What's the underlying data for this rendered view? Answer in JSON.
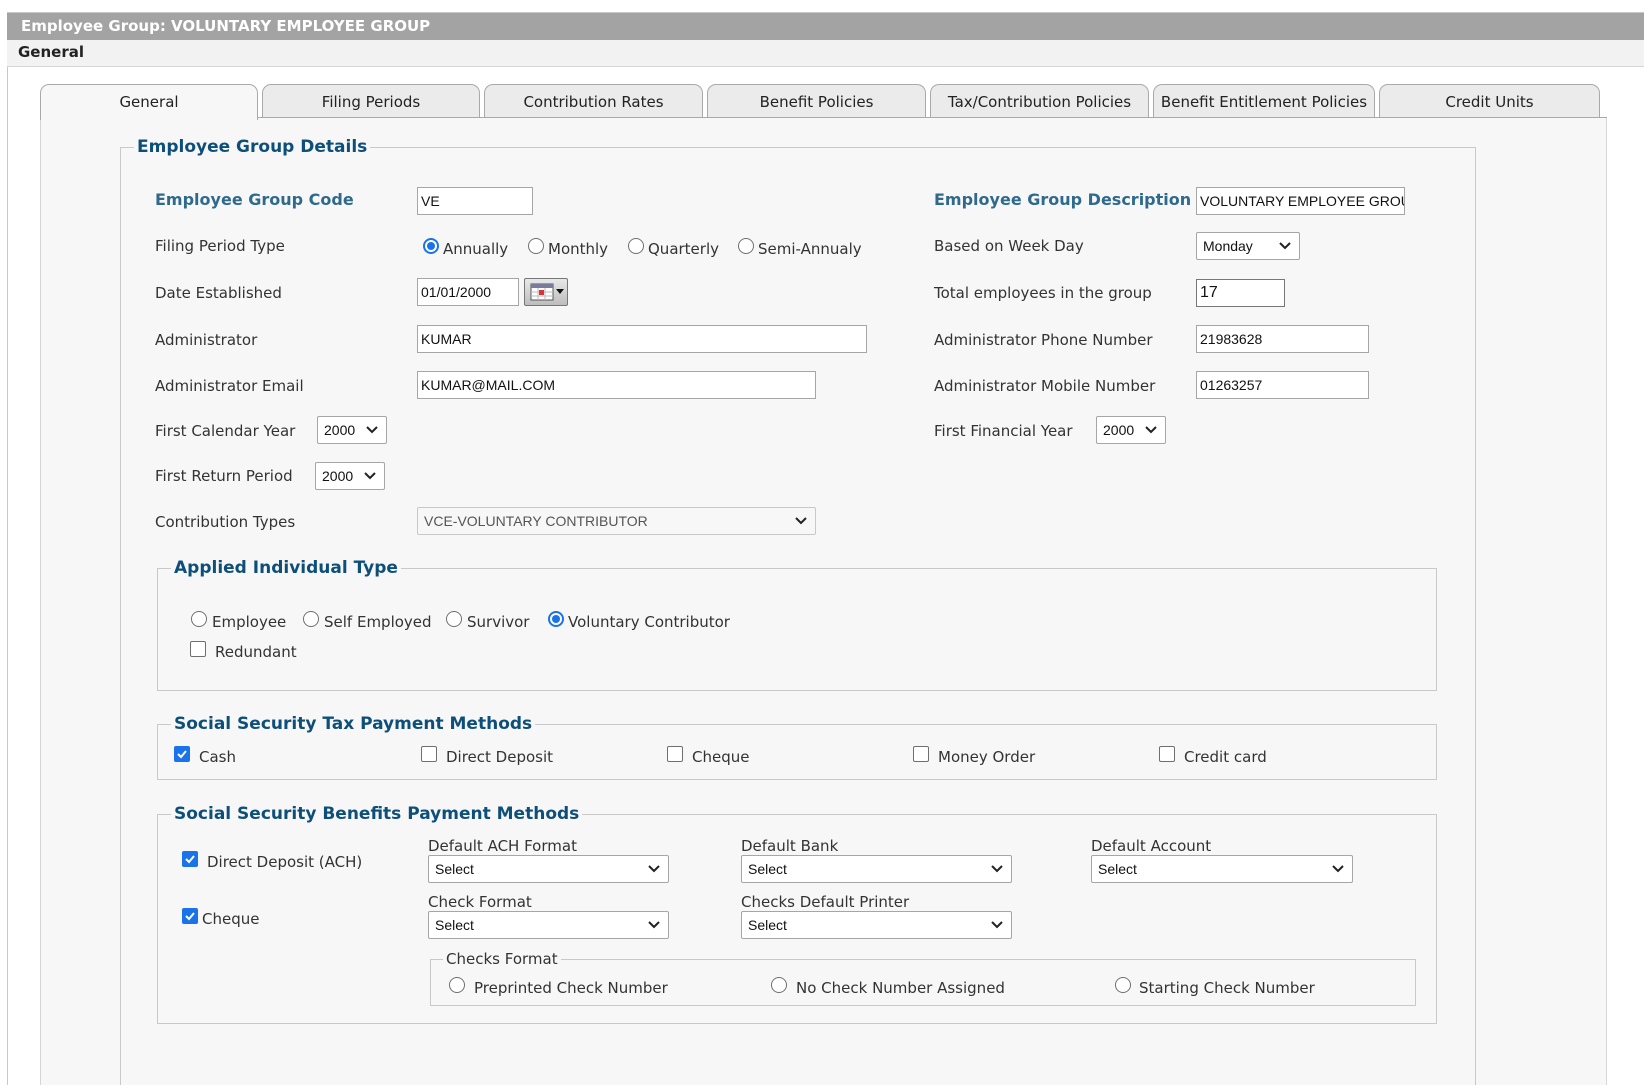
{
  "window": {
    "title": "Employee Group: VOLUNTARY EMPLOYEE GROUP",
    "section": "General"
  },
  "tabs": [
    "General",
    "Filing Periods",
    "Contribution Rates",
    "Benefit Policies",
    "Tax/Contribution Policies",
    "Benefit Entitlement Policies",
    "Credit Units"
  ],
  "active_tab": "General",
  "details": {
    "legend": "Employee Group Details",
    "code_label": "Employee Group Code",
    "code_value": "VE",
    "description_label": "Employee Group Description",
    "description_value": "VOLUNTARY EMPLOYEE GROUP",
    "filing_period_label": "Filing Period Type",
    "filing_period_options": [
      "Annually",
      "Monthly",
      "Quarterly",
      "Semi-Annualy"
    ],
    "filing_period_selected": "Annually",
    "week_day_label": "Based on Week Day",
    "week_day_value": "Monday",
    "date_label": "Date Established",
    "date_value": "01/01/2000",
    "total_label": "Total employees in the group",
    "total_value": "17",
    "admin_label": "Administrator",
    "admin_value": "KUMAR",
    "admin_phone_label": "Administrator Phone Number",
    "admin_phone_value": "21983628",
    "admin_email_label": "Administrator Email",
    "admin_email_value": "KUMAR@MAIL.COM",
    "admin_mobile_label": "Administrator Mobile Number",
    "admin_mobile_value": "01263257",
    "first_cal_year_label": "First Calendar Year",
    "first_cal_year_value": "2000",
    "first_fin_year_label": "First Financial Year",
    "first_fin_year_value": "2000",
    "first_return_label": "First Return Period",
    "first_return_value": "2000",
    "contribution_types_label": "Contribution Types",
    "contribution_types_value": "VCE-VOLUNTARY CONTRIBUTOR"
  },
  "applied_individual": {
    "legend": "Applied Individual Type",
    "options": [
      "Employee",
      "Self Employed",
      "Survivor",
      "Voluntary Contributor"
    ],
    "selected": "Voluntary Contributor",
    "redundant_label": "Redundant",
    "redundant_checked": false
  },
  "tax_payment": {
    "legend": "Social Security Tax Payment Methods",
    "methods": [
      {
        "label": "Cash",
        "checked": true
      },
      {
        "label": "Direct Deposit",
        "checked": false
      },
      {
        "label": "Cheque",
        "checked": false
      },
      {
        "label": "Money Order",
        "checked": false
      },
      {
        "label": "Credit card",
        "checked": false
      }
    ]
  },
  "benefits_payment": {
    "legend": "Social Security Benefits Payment Methods",
    "ach_label": "Direct Deposit (ACH)",
    "ach_checked": true,
    "cheque_label": "Cheque",
    "cheque_checked": true,
    "ach_format_label": "Default ACH Format",
    "ach_format_value": "Select",
    "bank_label": "Default Bank",
    "bank_value": "Select",
    "account_label": "Default Account",
    "account_value": "Select",
    "check_format_label": "Check Format",
    "check_format_value": "Select",
    "printer_label": "Checks Default Printer",
    "printer_value": "Select",
    "checks_format_legend": "Checks Format",
    "checks_format_options": [
      "Preprinted Check Number",
      "No Check Number Assigned",
      "Starting Check Number"
    ]
  },
  "colors": {
    "legend": "#0e4f7a",
    "label_strong": "#2f6a8c",
    "accent": "#1a73e8",
    "titlebar": "#a3a3a3"
  }
}
